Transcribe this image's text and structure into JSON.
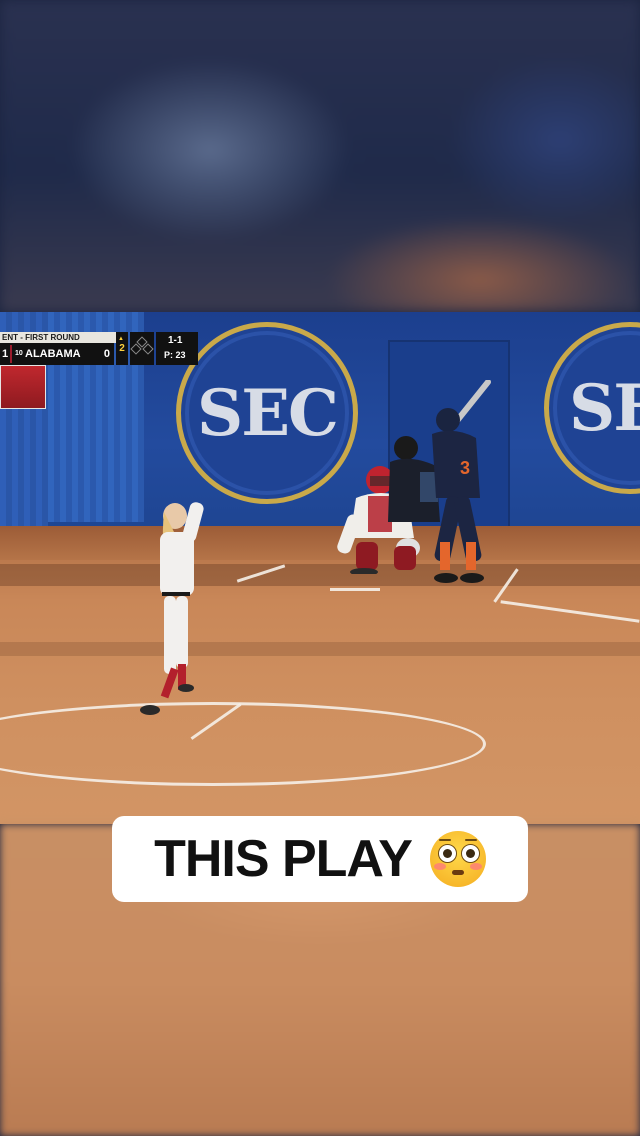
{
  "scorebug": {
    "round_label": "ENT - FIRST ROUND",
    "left_score": "1",
    "team_rank": "10",
    "team_name": "ALABAMA",
    "team_score": "0",
    "inning_arrow": "▲",
    "inning": "2",
    "count": "1-1",
    "pitch_count": "P: 23"
  },
  "wall": {
    "logo_text": "SEC",
    "logo_text_partial": "SE"
  },
  "players": {
    "batter_number": "3"
  },
  "caption": {
    "text": "THIS PLAY",
    "emoji": "flushed-face-emoji"
  },
  "colors": {
    "wall_blue": "#234b9e",
    "logo_gold": "#c9a94a",
    "dirt": "#c98758",
    "alabama_crimson": "#9b1c2c",
    "caption_bg": "#ffffff"
  }
}
